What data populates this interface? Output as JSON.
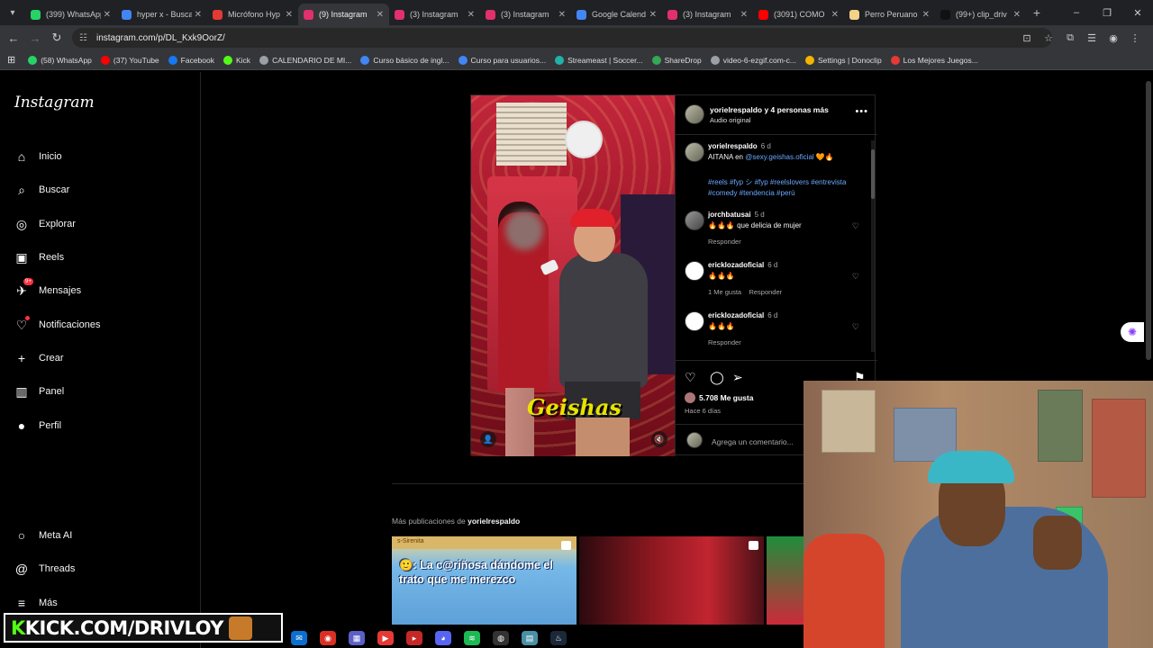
{
  "browser": {
    "tabs": [
      {
        "title": "(399) WhatsApp",
        "color": "#25d366"
      },
      {
        "title": "hyper x - Buscar",
        "color": "#4285f4"
      },
      {
        "title": "Micrófono Hyp",
        "color": "#e53935"
      },
      {
        "title": "(9) Instagram",
        "color": "#e1306c",
        "active": true
      },
      {
        "title": "(3) Instagram",
        "color": "#e1306c"
      },
      {
        "title": "(3) Instagram",
        "color": "#e1306c"
      },
      {
        "title": "Google Calend",
        "color": "#4285f4"
      },
      {
        "title": "(3) Instagram",
        "color": "#e1306c"
      },
      {
        "title": "(3091) COMO",
        "color": "#ff0000"
      },
      {
        "title": "Perro Peruano",
        "color": "#f4d28a"
      },
      {
        "title": "(99+) clip_driv",
        "color": "#111111"
      }
    ],
    "url": "instagram.com/p/DL_Kxk9OorZ/",
    "bookmarks": [
      {
        "label": "(58) WhatsApp",
        "color": "#25d366"
      },
      {
        "label": "(37) YouTube",
        "color": "#ff0000"
      },
      {
        "label": "Facebook",
        "color": "#1877f2"
      },
      {
        "label": "Kick",
        "color": "#53fc18"
      },
      {
        "label": "CALENDARIO DE MI...",
        "color": "#9aa0a6"
      },
      {
        "label": "Curso básico de ingl...",
        "color": "#4285f4"
      },
      {
        "label": "Curso para usuarios...",
        "color": "#4285f4"
      },
      {
        "label": "Streameast | Soccer...",
        "color": "#20b2aa"
      },
      {
        "label": "ShareDrop",
        "color": "#34a853"
      },
      {
        "label": "video-6-ezgif.com-c...",
        "color": "#9aa0a6"
      },
      {
        "label": "Settings | Donoclip",
        "color": "#f4b400"
      },
      {
        "label": "Los Mejores Juegos...",
        "color": "#e53935"
      }
    ]
  },
  "sidebar": {
    "logo": "Instagram",
    "items": [
      {
        "label": "Inicio",
        "icon": "⌂"
      },
      {
        "label": "Buscar",
        "icon": "⌕"
      },
      {
        "label": "Explorar",
        "icon": "◎"
      },
      {
        "label": "Reels",
        "icon": "▣"
      },
      {
        "label": "Mensajes",
        "icon": "✈",
        "badge": "9+"
      },
      {
        "label": "Notificaciones",
        "icon": "♡",
        "dot": true
      },
      {
        "label": "Crear",
        "icon": "+"
      },
      {
        "label": "Panel",
        "icon": "▥"
      },
      {
        "label": "Perfil",
        "icon": "●"
      }
    ],
    "bottom": [
      {
        "label": "Meta AI",
        "icon": "○"
      },
      {
        "label": "Threads",
        "icon": "@"
      },
      {
        "label": "Más",
        "icon": "≡"
      }
    ]
  },
  "post": {
    "header_title": "yorielrespaldo y 4 personas más",
    "audio": "Audio original",
    "watermark": "Geishas",
    "caption_user": "yorielrespaldo",
    "caption_time": "6 d",
    "caption_text": "AITANA en",
    "caption_mention": "@sexy.geishas.oficial",
    "caption_emoji": "🧡🔥",
    "hashtags": "#reels #fyp シ #fyp #reelslovers #entrevista #comedy #tendencia #perù",
    "comments": [
      {
        "user": "jorchbatusai",
        "time": "5 d",
        "text": "🔥🔥🔥 que delicia de mujer",
        "likes": "",
        "reply": "Responder"
      },
      {
        "user": "ericklozadoficial",
        "time": "6 d",
        "text": "🔥🔥🔥",
        "likes": "1 Me gusta",
        "reply": "Responder"
      },
      {
        "user": "ericklozadoficial",
        "time": "6 d",
        "text": "🔥🔥🔥",
        "likes": "",
        "reply": "Responder"
      }
    ],
    "likes": "5.708 Me gusta",
    "time_ago": "Hace 6 días",
    "comment_placeholder": "Agrega un comentario..."
  },
  "more": {
    "label": "Más publicaciones de",
    "user": "yorielrespaldo",
    "thumb1_text": "🙂: La c@riñosa dándome el trato que me merezco",
    "thumb1_strip": "s-Sirenita"
  },
  "overlay": {
    "kick_prefix": "K",
    "kick_text": "KICK.COM/DRIVLOY"
  }
}
